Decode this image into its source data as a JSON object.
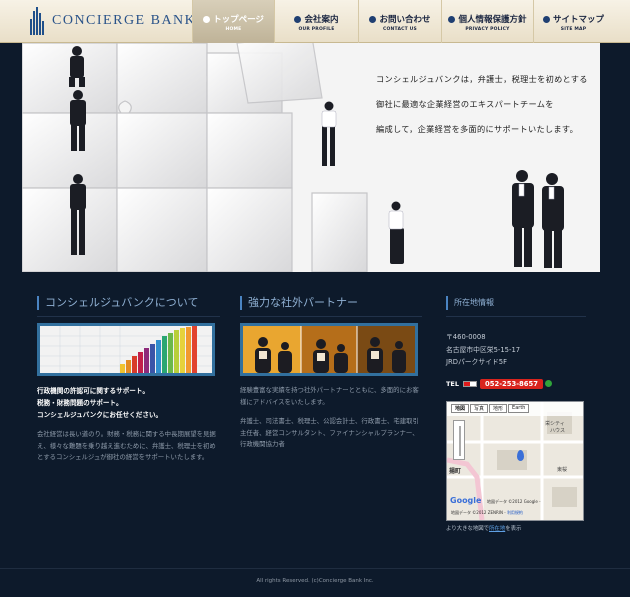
{
  "header": {
    "logo_text": "CONCIERGE BANK",
    "nav": [
      {
        "label": "トップページ",
        "sub": "HOME",
        "active": true
      },
      {
        "label": "会社案内",
        "sub": "OUR PROFILE",
        "active": false
      },
      {
        "label": "お問い合わせ",
        "sub": "CONTACT US",
        "active": false
      },
      {
        "label": "個人情報保護方針",
        "sub": "PRIVACY POLICY",
        "active": false
      },
      {
        "label": "サイトマップ",
        "sub": "SITE MAP",
        "active": false
      }
    ]
  },
  "hero": {
    "lines": [
      "コンシェルジュバンクは，弁護士，税理士を初めとする",
      "御社に最適な企業経営のエキスパートチームを",
      "編成して，企業経営を多面的にサポートいたします。"
    ]
  },
  "about": {
    "title": "コンシェルジュバンクについて",
    "lead": [
      "行政機関の許認可に関するサポート。",
      "税務・財務問題のサポート。",
      "コンシェルジュバンクにお任せください。"
    ],
    "body": "会社経営は長い道のり。財務・税務に関する中長期展望を見据え、様々な難題を乗り越え進むために、弁護士、税理士を初めとするコンシェルジュが御社の経営をサポートいたします。"
  },
  "partners": {
    "title": "強力な社外パートナー",
    "intro": "経験豊富な実績を持つ社外パートナーとともに、多面的にお客様にアドバイスをいたします。",
    "list": "弁護士、司法書士、税理士、公認会計士、行政書士、宅建取引主任者、経営コンサルタント、ファイナンシャルプランナー、行政機関協力者"
  },
  "location": {
    "title": "所在地情報",
    "address": [
      "〒460-0008",
      "名古屋市中区栄5-15-17",
      "JRDパークサイド5F"
    ],
    "tel_label": "TEL",
    "tel": "052-253-8657",
    "map": {
      "tabs": [
        "地図",
        "写真",
        "地形",
        "Earth"
      ],
      "labels": [
        "栄シティ",
        "ハウス",
        "揚町",
        "東桜"
      ],
      "attribution": "地図データ ©2012 Google -",
      "attribution2": "地図データ ©2012 ZENRIN -",
      "terms": "利用規約",
      "google": "Google"
    },
    "caption_pre": "より大きな地図で",
    "caption_link": "所在地",
    "caption_post": "を表示"
  },
  "footer": {
    "copyright": "All rights Reserved. (c)Concierge Bank Inc."
  },
  "colors": {
    "background": "#0d1a2b",
    "header": "#efe6d2",
    "accent": "#32709e",
    "tel": "#d9241d"
  }
}
